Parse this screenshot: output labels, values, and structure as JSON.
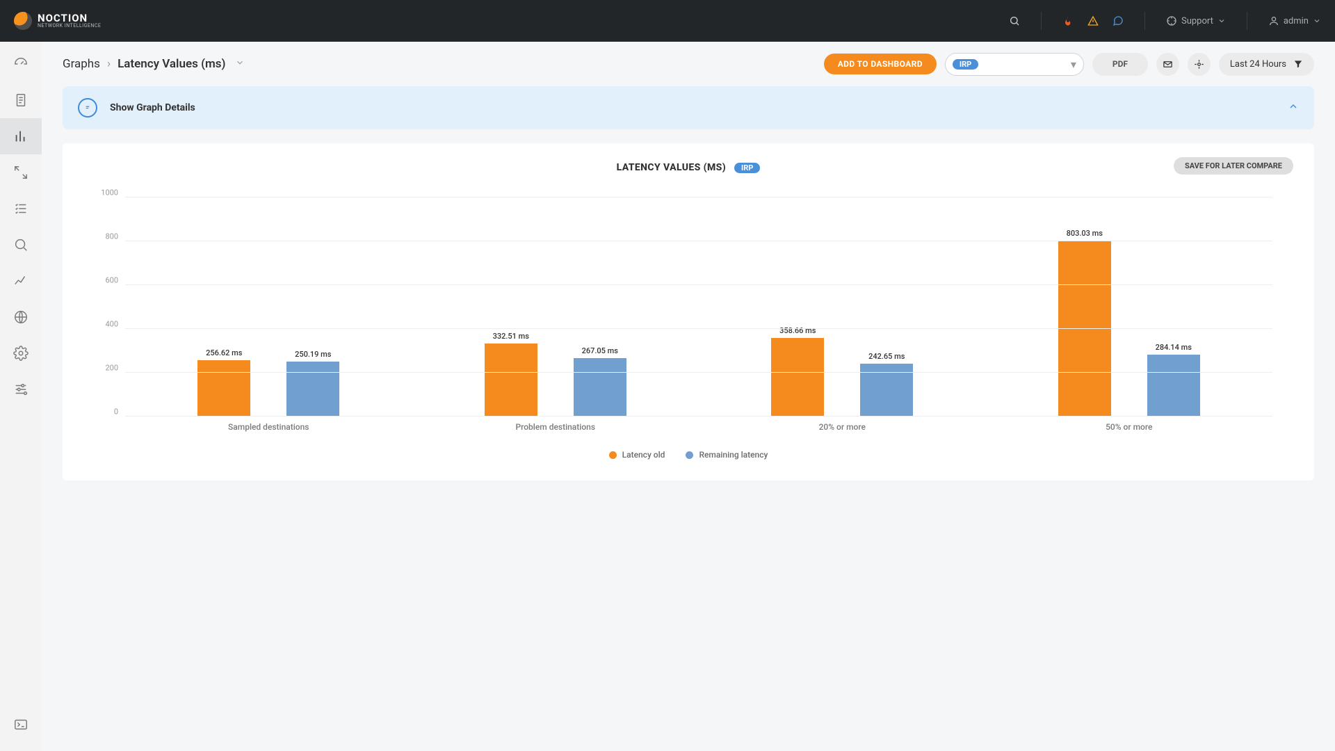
{
  "header": {
    "brand": "NOCTION",
    "brand_sub": "NETWORK INTELLIGENCE",
    "support_label": "Support",
    "user_label": "admin"
  },
  "breadcrumb": {
    "root": "Graphs",
    "leaf": "Latency Values (ms)"
  },
  "actions": {
    "add_dashboard": "ADD TO DASHBOARD",
    "irp_badge": "IRP",
    "pdf": "PDF",
    "timerange": "Last 24 Hours"
  },
  "details_banner": "Show Graph Details",
  "chart": {
    "title": "LATENCY VALUES (MS)",
    "title_badge": "IRP",
    "save_compare": "SAVE FOR LATER COMPARE",
    "legend_old": "Latency old",
    "legend_new": "Remaining latency",
    "value_unit": "ms"
  },
  "chart_data": {
    "type": "bar",
    "title": "LATENCY VALUES (MS)",
    "xlabel": "",
    "ylabel": "",
    "ylim": [
      0,
      1000
    ],
    "y_ticks": [
      0,
      200,
      400,
      600,
      800,
      1000
    ],
    "categories": [
      "Sampled destinations",
      "Problem destinations",
      "20% or more",
      "50% or more"
    ],
    "series": [
      {
        "name": "Latency old",
        "color": "#f58b1f",
        "values": [
          256.62,
          332.51,
          358.66,
          803.03
        ]
      },
      {
        "name": "Remaining latency",
        "color": "#719fcf",
        "values": [
          250.19,
          267.05,
          242.65,
          284.14
        ]
      }
    ]
  }
}
